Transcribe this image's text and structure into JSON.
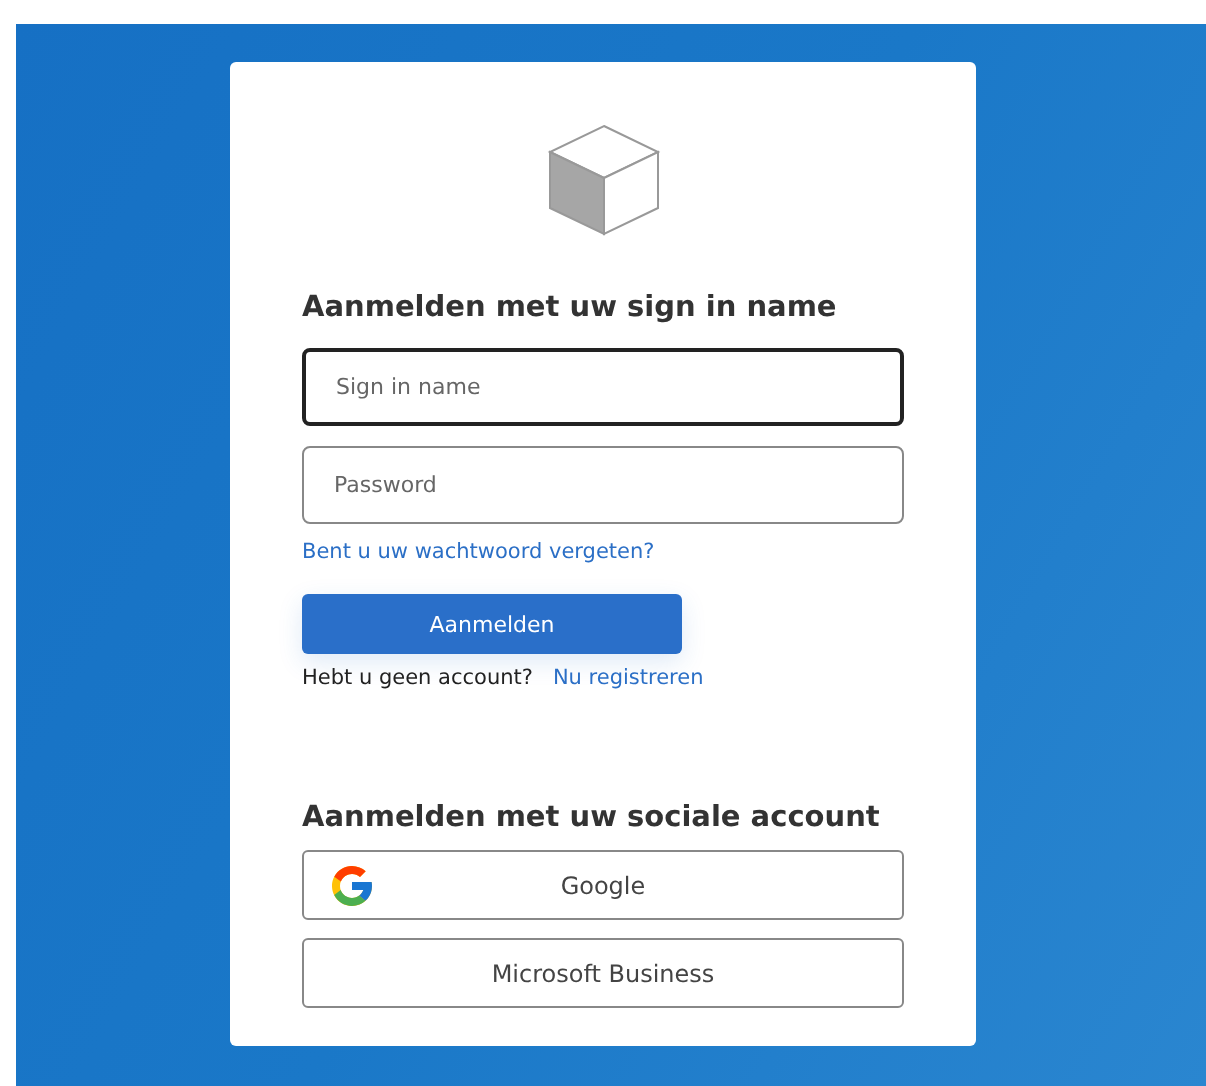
{
  "heading": "Aanmelden met uw sign in name",
  "fields": [
    {
      "placeholder": "Sign in name",
      "focused": true
    },
    {
      "placeholder": "Password",
      "focused": false
    }
  ],
  "forgot_link": "Bent u uw wachtwoord vergeten?",
  "submit_button": "Aanmelden",
  "signup": {
    "text": "Hebt u geen account?",
    "link": "Nu registreren"
  },
  "social_heading": "Aanmelden met uw sociale account",
  "social_buttons": [
    {
      "label": "Google",
      "kind": "google"
    },
    {
      "label": "Microsoft Business",
      "kind": "plain"
    }
  ]
}
